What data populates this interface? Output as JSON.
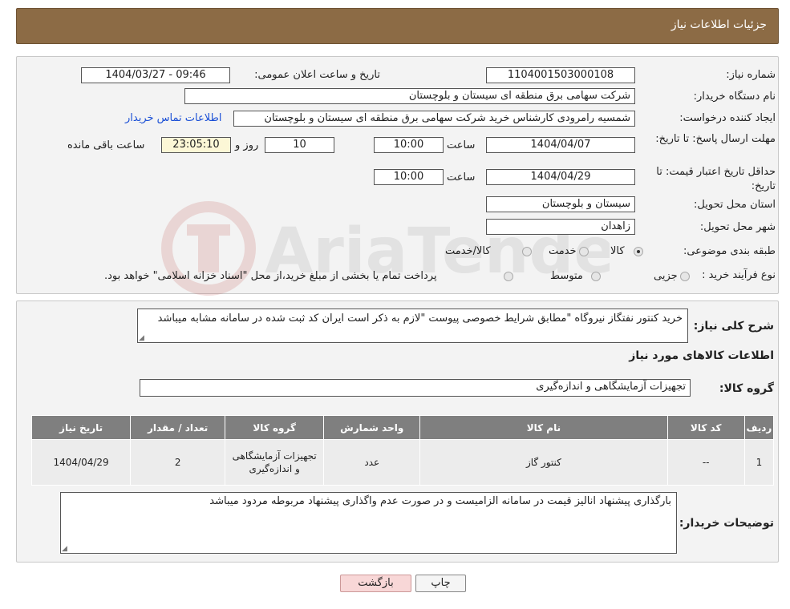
{
  "header": {
    "title": "جزئیات اطلاعات نیاز"
  },
  "form": {
    "need_number_label": "شماره نیاز:",
    "need_number": "1104001503000108",
    "announce_label": "تاریخ و ساعت اعلان عمومی:",
    "announce_value": "1404/03/27 - 09:46",
    "buyer_label": "نام دستگاه خریدار:",
    "buyer": "شرکت سهامی برق منطقه ای سیستان و بلوچستان",
    "creator_label": "ایجاد کننده درخواست:",
    "creator": "شمسیه رامرودی کارشناس خرید شرکت سهامی برق منطقه ای سیستان و بلوچستان",
    "contact_link": "اطلاعات تماس خریدار",
    "deadline_label": "مهلت ارسال پاسخ: تا تاریخ:",
    "deadline_date": "1404/04/07",
    "time_label": "ساعت",
    "deadline_time": "10:00",
    "days_value": "10",
    "days_label": "روز و",
    "remaining_time": "23:05:10",
    "remaining_label": "ساعت باقی مانده",
    "validity_label": "حداقل تاریخ اعتبار قیمت: تا تاریخ:",
    "validity_date": "1404/04/29",
    "validity_time": "10:00",
    "province_label": "استان محل تحویل:",
    "province": "سیستان و بلوچستان",
    "city_label": "شهر محل تحویل:",
    "city": "زاهدان",
    "category_label": "طبقه بندی موضوعی:",
    "category_options": [
      "کالا",
      "خدمت",
      "کالا/خدمت"
    ],
    "category_selected": "کالا",
    "process_label": "نوع فرآیند خرید :",
    "process_options": [
      "جزیی",
      "متوسط"
    ],
    "process_note": "پرداخت تمام یا بخشی از مبلغ خرید،از محل \"اسناد خزانه اسلامی\" خواهد بود."
  },
  "need": {
    "description_label": "شرح کلی نیاز:",
    "description": "خرید کنتور نفتگاز نیروگاه \"مطابق شرایط خصوصی پیوست \"لازم به ذکر است ایران کد ثبت شده در سامانه مشابه میباشد",
    "items_title": "اطلاعات کالاهای مورد نیاز",
    "group_label": "گروه کالا:",
    "group_value": "تجهیزات آزمایشگاهی و اندازه‌گیری"
  },
  "table": {
    "headers": [
      "ردیف",
      "کد کالا",
      "نام کالا",
      "واحد شمارش",
      "گروه کالا",
      "تعداد / مقدار",
      "تاریخ نیاز"
    ],
    "rows": [
      [
        "1",
        "--",
        "کنتور گاز",
        "عدد",
        "تجهیزات آزمایشگاهی و اندازه‌گیری",
        "2",
        "1404/04/29"
      ]
    ]
  },
  "notes": {
    "label": "توضیحات خریدار:",
    "text": "بارگذاری پیشنهاد انالیز قیمت در سامانه الزامیست و در صورت عدم واگذاری پیشنهاد مربوطه مردود میباشد"
  },
  "buttons": {
    "print": "چاپ",
    "back": "بازگشت"
  },
  "watermark": {
    "text": "AriaTender.neT"
  },
  "colors": {
    "header_bg": "#8c6b45",
    "link": "#1a4fd6",
    "table_header": "#7f7f7f",
    "back_button_bg": "#f8d7d7"
  }
}
